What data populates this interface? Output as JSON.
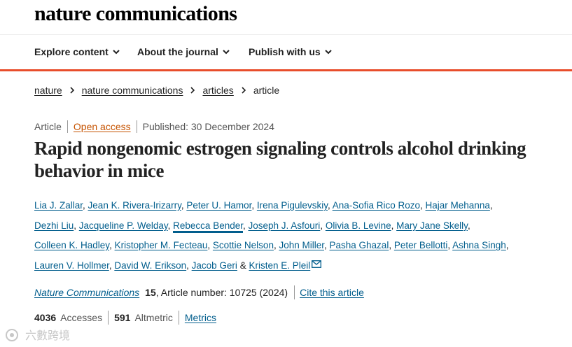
{
  "header": {
    "logo": "nature communications"
  },
  "nav": {
    "items": [
      {
        "label": "Explore content"
      },
      {
        "label": "About the journal"
      },
      {
        "label": "Publish with us"
      }
    ]
  },
  "breadcrumb": [
    "nature",
    "nature communications",
    "articles",
    "article"
  ],
  "article_meta": {
    "type": "Article",
    "access": "Open access",
    "published": "Published: 30 December 2024"
  },
  "title": "Rapid nongenomic estrogen signaling controls alcohol drinking behavior in mice",
  "authors": [
    "Lia J. Zallar",
    "Jean K. Rivera-Irizarry",
    "Peter U. Hamor",
    "Irena Pigulevskiy",
    "Ana-Sofia Rico Rozo",
    "Hajar Mehanna",
    "Dezhi Liu",
    "Jacqueline P. Welday",
    "Rebecca Bender",
    "Joseph J. Asfouri",
    "Olivia B. Levine",
    "Mary Jane Skelly",
    "Colleen K. Hadley",
    "Kristopher M. Fecteau",
    "Scottie Nelson",
    "John Miller",
    "Pasha Ghazal",
    "Peter Bellotti",
    "Ashna Singh",
    "Lauren V. Hollmer",
    "David W. Erikson",
    "Jacob Geri",
    "Kristen E. Pleil"
  ],
  "authors_conjunction": "&",
  "citation": {
    "journal": "Nature Communications",
    "volume": "15",
    "article_number": ", Article number: 10725 (2024)",
    "cite_link": "Cite this article"
  },
  "metrics": {
    "accesses_value": "4036",
    "accesses_label": "Accesses",
    "altmetric_value": "591",
    "altmetric_label": "Altmetric",
    "metrics_link": "Metrics"
  },
  "watermark": {
    "text": "六數跨境"
  },
  "colors": {
    "accent_red": "#e84d2b",
    "link_blue": "#025e8d",
    "open_access": "#c65301"
  },
  "icons": [
    "chevron-down-icon",
    "chevron-right-icon",
    "mail-icon"
  ]
}
